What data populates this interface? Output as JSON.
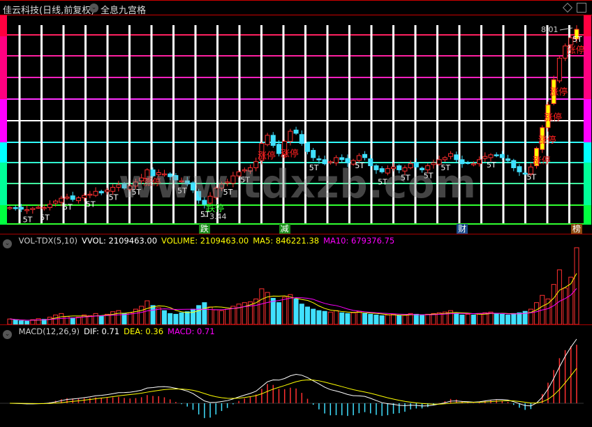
{
  "header": {
    "title": "佳云科技(日线,前复权)",
    "view_label": "全息九宫格",
    "icons": [
      "dropdown-icon",
      "diamond-icon",
      "window-toggle-icon"
    ]
  },
  "watermark": "www.tdxzb.com",
  "price_panel": {
    "high_label": "8.01",
    "low_label": "3.44",
    "bottom_tags": [
      {
        "text": "跌",
        "color": "#1a8a1a",
        "idx": 34
      },
      {
        "text": "减",
        "color": "#1a8a1a",
        "idx": 48
      },
      {
        "text": "财",
        "color": "#1a4a8a",
        "idx": 79
      },
      {
        "text": "榜",
        "color": "#8a4a10",
        "idx": 99
      }
    ]
  },
  "volume_panel": {
    "indicator": "VOL-TDX(5,10)",
    "vvol": "VVOL: 2109463.00",
    "volume": "VOLUME: 2109463.00",
    "ma5": "MA5: 846221.38",
    "ma10": "MA10: 679376.75"
  },
  "macd_panel": {
    "indicator": "MACD(12,26,9)",
    "dif": "DIF: 0.71",
    "dea": "DEA: 0.36",
    "macd": "MACD: 0.71"
  },
  "colors": {
    "up": "#ff3030",
    "down": "#40e0ff",
    "limit": "#ffff00",
    "dif": "#ffffff",
    "dea": "#ffff00",
    "ma5": "#ffff00",
    "ma10": "#ff00ff"
  },
  "chart_data": {
    "type": "candlestick",
    "price_range": [
      3.44,
      8.01
    ],
    "close": [
      3.62,
      3.6,
      3.58,
      3.57,
      3.6,
      3.63,
      3.62,
      3.7,
      3.78,
      3.85,
      3.88,
      3.82,
      3.86,
      3.92,
      3.95,
      4.02,
      3.98,
      4.05,
      4.12,
      4.18,
      4.1,
      4.15,
      4.25,
      4.35,
      4.55,
      4.4,
      4.48,
      4.45,
      4.38,
      4.3,
      4.28,
      4.2,
      4.05,
      3.8,
      3.7,
      3.9,
      4.1,
      4.2,
      4.25,
      4.4,
      4.5,
      4.55,
      4.6,
      4.75,
      5.2,
      5.4,
      5.15,
      4.95,
      5.25,
      5.5,
      5.45,
      5.2,
      5.0,
      4.85,
      4.8,
      4.7,
      4.75,
      4.85,
      4.8,
      4.72,
      4.78,
      4.9,
      4.85,
      4.65,
      4.55,
      4.5,
      4.58,
      4.62,
      4.55,
      4.6,
      4.7,
      4.62,
      4.55,
      4.65,
      4.72,
      4.8,
      4.85,
      4.95,
      4.8,
      4.7,
      4.72,
      4.7,
      4.8,
      4.88,
      4.92,
      4.9,
      4.85,
      4.78,
      4.6,
      4.5,
      4.45,
      4.62,
      5.08,
      5.59,
      6.15,
      6.77,
      7.3,
      7.6,
      7.8,
      8.01
    ],
    "volume": [
      150000,
      120000,
      100000,
      90000,
      130000,
      160000,
      140000,
      200000,
      260000,
      300000,
      220000,
      180000,
      200000,
      260000,
      240000,
      300000,
      220000,
      280000,
      350000,
      380000,
      300000,
      320000,
      420000,
      500000,
      650000,
      520000,
      460000,
      380000,
      300000,
      280000,
      320000,
      350000,
      420000,
      520000,
      600000,
      480000,
      400000,
      380000,
      420000,
      500000,
      560000,
      600000,
      620000,
      700000,
      980000,
      880000,
      720000,
      600000,
      750000,
      820000,
      700000,
      560000,
      480000,
      420000,
      380000,
      360000,
      340000,
      380000,
      320000,
      300000,
      320000,
      360000,
      300000,
      280000,
      260000,
      240000,
      260000,
      280000,
      240000,
      250000,
      300000,
      280000,
      260000,
      280000,
      300000,
      320000,
      340000,
      380000,
      300000,
      260000,
      280000,
      260000,
      300000,
      320000,
      340000,
      300000,
      280000,
      260000,
      300000,
      320000,
      360000,
      420000,
      600000,
      800000,
      700000,
      1100000,
      1500000,
      1000000,
      1300000,
      2109463
    ],
    "limit_up": [
      92,
      93,
      94,
      95,
      99
    ],
    "markers": [
      {
        "idx": 3,
        "text": "5T"
      },
      {
        "idx": 6,
        "text": "5T"
      },
      {
        "idx": 10,
        "text": "5T"
      },
      {
        "idx": 14,
        "text": "5T"
      },
      {
        "idx": 18,
        "text": "5T"
      },
      {
        "idx": 22,
        "text": "5T"
      },
      {
        "idx": 30,
        "text": "5T"
      },
      {
        "idx": 34,
        "text": "5T"
      },
      {
        "idx": 38,
        "text": "5T"
      },
      {
        "idx": 41,
        "text": "5T"
      },
      {
        "idx": 53,
        "text": "5T"
      },
      {
        "idx": 61,
        "text": "5T"
      },
      {
        "idx": 65,
        "text": "5T"
      },
      {
        "idx": 69,
        "text": "5T"
      },
      {
        "idx": 73,
        "text": "5T"
      },
      {
        "idx": 76,
        "text": "5T"
      },
      {
        "idx": 84,
        "text": "5T"
      },
      {
        "idx": 91,
        "text": "5T"
      },
      {
        "idx": 99,
        "text": "5T"
      },
      {
        "idx": 24,
        "text": "涨停",
        "color": "#ff2020"
      },
      {
        "idx": 44,
        "text": "涨停",
        "color": "#ff2020"
      },
      {
        "idx": 48,
        "text": "涨停",
        "color": "#ff2020"
      },
      {
        "idx": 35,
        "text": "跌停",
        "color": "#30ff30"
      },
      {
        "idx": 92,
        "text": "涨停",
        "color": "#ff2020"
      },
      {
        "idx": 93,
        "text": "涨停",
        "color": "#ff2020"
      },
      {
        "idx": 94,
        "text": "涨停",
        "color": "#ff2020"
      },
      {
        "idx": 95,
        "text": "涨停",
        "color": "#ff2020"
      },
      {
        "idx": 98,
        "text": "涨停",
        "color": "#ff2020"
      }
    ]
  }
}
